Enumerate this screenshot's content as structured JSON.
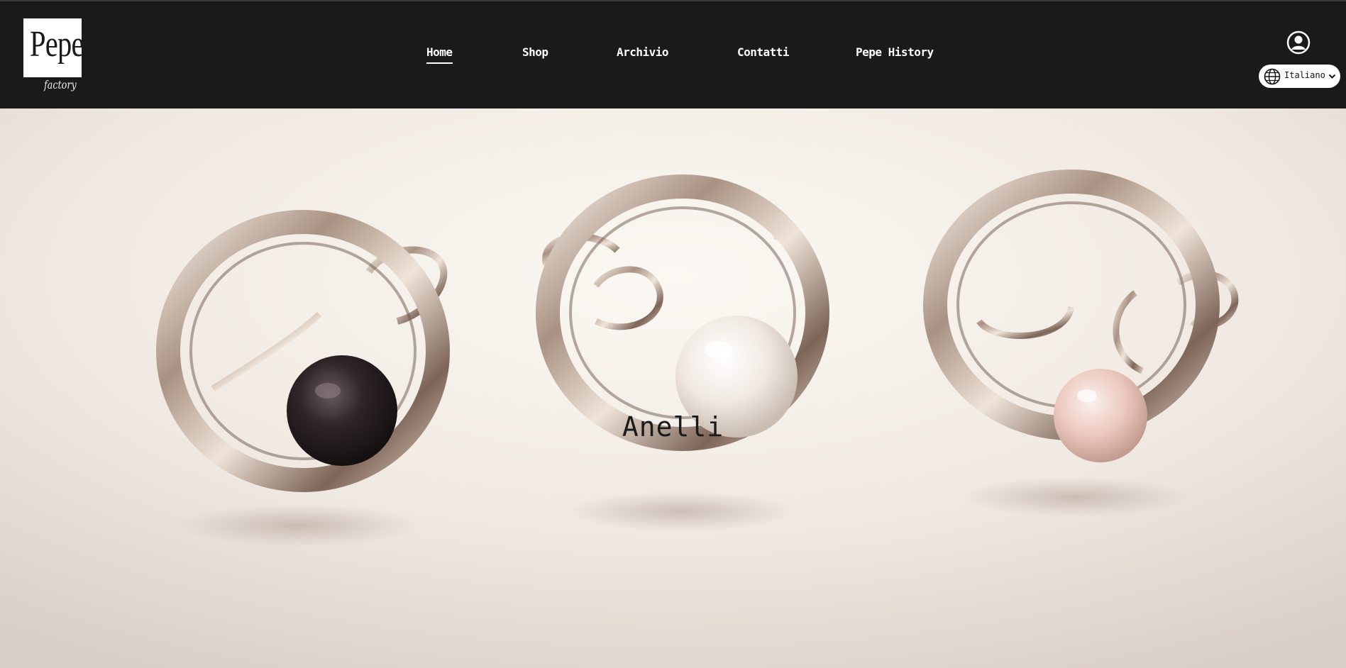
{
  "header": {
    "logo": {
      "word": "Pepe",
      "sub": "factory"
    },
    "nav": [
      {
        "label": "Home",
        "active": true
      },
      {
        "label": "Shop",
        "active": false
      },
      {
        "label": "Archivio",
        "active": false
      },
      {
        "label": "Contatti",
        "active": false
      },
      {
        "label": "Pepe History",
        "active": false
      }
    ],
    "account_icon": "user-circle-icon",
    "language": {
      "selected": "Italiano",
      "icon": "globe-icon",
      "chevron": "chevron-down-icon"
    }
  },
  "hero": {
    "title": "Anelli",
    "image": "three-silver-rings-with-pearls"
  },
  "colors": {
    "header_bg": "#1a1a1a",
    "text_light": "#ffffff",
    "hero_bg": "#f2ece6"
  }
}
